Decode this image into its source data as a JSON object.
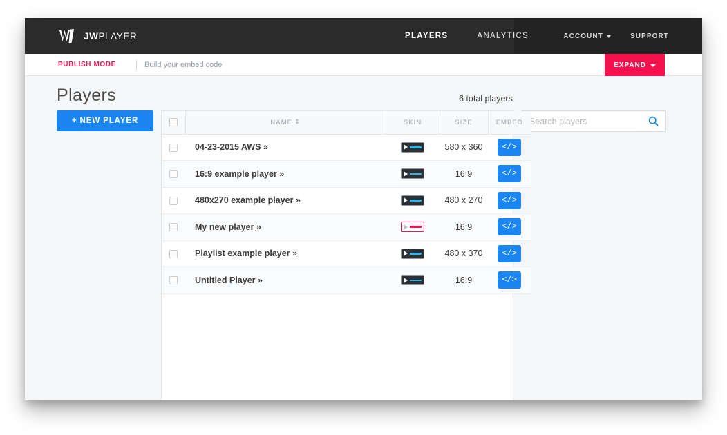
{
  "brand": {
    "logo_text_bold": "JW",
    "logo_text_light": "PLAYER",
    "logo_mark": "jwplayer-w-logo",
    "accent_pink": "#F5114E",
    "accent_blue": "#1B86F0",
    "nav_bg": "#2B2B2B",
    "nav_bg_right": "#232323",
    "page_bg": "#F4F6F8"
  },
  "topnav": {
    "tabs": [
      {
        "label": "PLAYERS",
        "active": true
      },
      {
        "label": "ANALYTICS",
        "active": false
      }
    ],
    "right": [
      {
        "label": "ACCOUNT",
        "has_caret": true
      },
      {
        "label": "SUPPORT",
        "has_caret": false
      }
    ]
  },
  "subbar": {
    "publish_mode": "PUBLISH MODE",
    "hint": "Build your embed code",
    "expand_label": "EXPAND"
  },
  "page": {
    "title": "Players",
    "total_players": "6 total players",
    "new_player_label": "+ NEW PLAYER"
  },
  "search": {
    "placeholder": "Search players",
    "value": "",
    "icon": "search-icon"
  },
  "table": {
    "columns": [
      {
        "key": "check",
        "label": ""
      },
      {
        "key": "name",
        "label": "NAME",
        "sortable": true,
        "sort_glyph": "⇕"
      },
      {
        "key": "skin",
        "label": "SKIN"
      },
      {
        "key": "size",
        "label": "SIZE"
      },
      {
        "key": "embed",
        "label": "EMBED"
      }
    ],
    "embed_button_label": "</>",
    "rows": [
      {
        "name": "04-23-2015 AWS »",
        "skin": "dark",
        "size": "580 x 360",
        "checked": false
      },
      {
        "name": "16:9 example player »",
        "skin": "dark",
        "size": "16:9",
        "checked": false
      },
      {
        "name": "480x270 example player »",
        "skin": "dark",
        "size": "480 x 270",
        "checked": false
      },
      {
        "name": "My new player »",
        "skin": "pink",
        "size": "16:9",
        "checked": false
      },
      {
        "name": "Playlist example player »",
        "skin": "dark",
        "size": "480 x 370",
        "checked": false
      },
      {
        "name": "Untitled Player »",
        "skin": "dark",
        "size": "16:9",
        "checked": false
      }
    ]
  }
}
